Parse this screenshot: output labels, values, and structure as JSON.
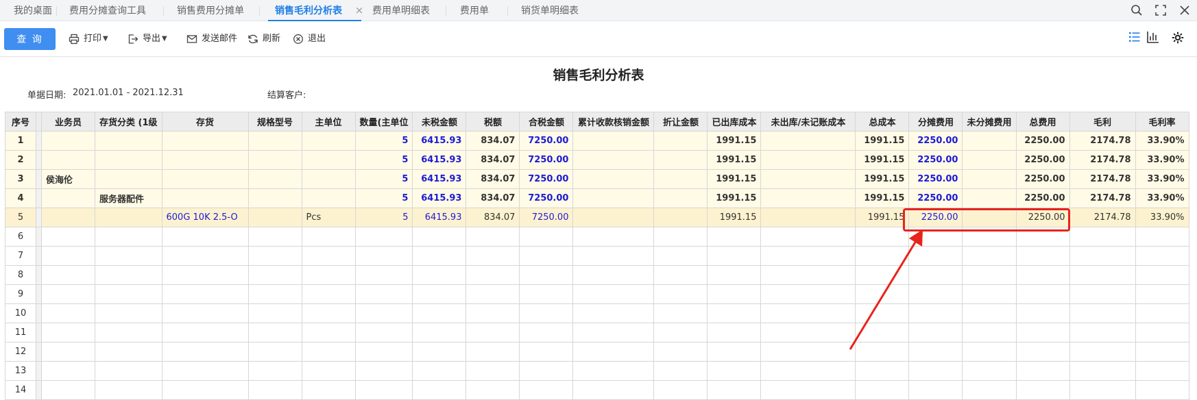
{
  "tabs": [
    {
      "label": "我的桌面",
      "active": false
    },
    {
      "label": "费用分摊查询工具",
      "active": false
    },
    {
      "label": "销售费用分摊单",
      "active": false
    },
    {
      "label": "销售毛利分析表",
      "active": true
    },
    {
      "label": "费用单明细表",
      "active": false
    },
    {
      "label": "费用单",
      "active": false
    },
    {
      "label": "销货单明细表",
      "active": false
    }
  ],
  "toolbar": {
    "query_label": "查 询",
    "print_label": "打印",
    "export_label": "导出",
    "email_label": "发送邮件",
    "refresh_label": "刷新",
    "exit_label": "退出"
  },
  "report": {
    "title": "销售毛利分析表",
    "date_label": "单据日期:",
    "date_value": "2021.01.01 - 2021.12.31",
    "customer_label": "结算客户:"
  },
  "columns": [
    "序号",
    "",
    "业务员",
    "存货分类 (1级",
    "存货",
    "规格型号",
    "主单位",
    "数量(主单位",
    "未税金额",
    "税额",
    "合税金额",
    "累计收款核销金额",
    "折让金额",
    "已出库成本",
    "未出库/未记账成本",
    "总成本",
    "分摊费用",
    "未分摊费用",
    "总费用",
    "毛利",
    "毛利率"
  ],
  "rows": [
    {
      "idx": "1",
      "salesman": "",
      "category": "",
      "item": "",
      "spec": "",
      "unit": "",
      "qty": "5",
      "net": "6415.93",
      "tax": "834.07",
      "gross": "7250.00",
      "collected": "",
      "discount": "",
      "shipped_cost": "1991.15",
      "unshipped_cost": "",
      "total_cost": "1991.15",
      "allocated": "2250.00",
      "unallocated": "",
      "total_expense": "2250.00",
      "profit": "2174.78",
      "margin": "33.90%"
    },
    {
      "idx": "2",
      "salesman": "",
      "category": "",
      "item": "",
      "spec": "",
      "unit": "",
      "qty": "5",
      "net": "6415.93",
      "tax": "834.07",
      "gross": "7250.00",
      "collected": "",
      "discount": "",
      "shipped_cost": "1991.15",
      "unshipped_cost": "",
      "total_cost": "1991.15",
      "allocated": "2250.00",
      "unallocated": "",
      "total_expense": "2250.00",
      "profit": "2174.78",
      "margin": "33.90%"
    },
    {
      "idx": "3",
      "salesman": "侯海伦",
      "category": "",
      "item": "",
      "spec": "",
      "unit": "",
      "qty": "5",
      "net": "6415.93",
      "tax": "834.07",
      "gross": "7250.00",
      "collected": "",
      "discount": "",
      "shipped_cost": "1991.15",
      "unshipped_cost": "",
      "total_cost": "1991.15",
      "allocated": "2250.00",
      "unallocated": "",
      "total_expense": "2250.00",
      "profit": "2174.78",
      "margin": "33.90%"
    },
    {
      "idx": "4",
      "salesman": "",
      "category": "服务器配件",
      "item": "",
      "spec": "",
      "unit": "",
      "qty": "5",
      "net": "6415.93",
      "tax": "834.07",
      "gross": "7250.00",
      "collected": "",
      "discount": "",
      "shipped_cost": "1991.15",
      "unshipped_cost": "",
      "total_cost": "1991.15",
      "allocated": "2250.00",
      "unallocated": "",
      "total_expense": "2250.00",
      "profit": "2174.78",
      "margin": "33.90%"
    },
    {
      "idx": "5",
      "salesman": "",
      "category": "",
      "item": "600G 10K 2.5-O",
      "spec": "",
      "unit": "Pcs",
      "qty": "5",
      "net": "6415.93",
      "tax": "834.07",
      "gross": "7250.00",
      "collected": "",
      "discount": "",
      "shipped_cost": "1991.15",
      "unshipped_cost": "",
      "total_cost": "1991.15",
      "allocated": "2250.00",
      "unallocated": "",
      "total_expense": "2250.00",
      "profit": "2174.78",
      "margin": "33.90%"
    }
  ],
  "empty_rows": [
    "6",
    "7",
    "8",
    "9",
    "10",
    "11",
    "12",
    "13",
    "14"
  ],
  "colors": {
    "accent": "#1e7fe8",
    "annotation": "#e8231b",
    "link_blue": "#1b1bd6"
  }
}
